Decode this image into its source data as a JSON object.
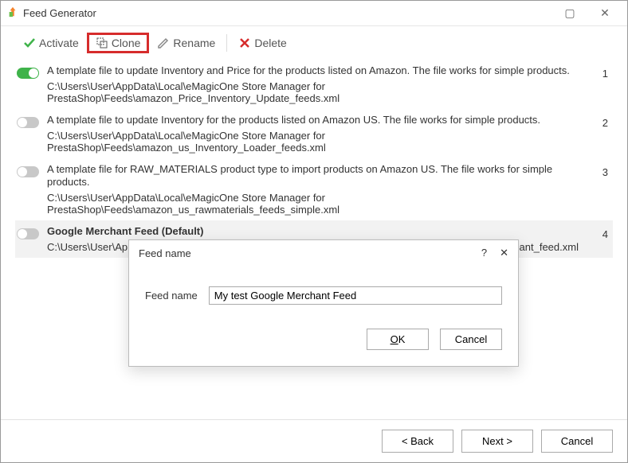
{
  "window": {
    "title": "Feed Generator",
    "maximize": "▢",
    "close": "✕"
  },
  "toolbar": {
    "activate": "Activate",
    "clone": "Clone",
    "rename": "Rename",
    "delete": "Delete"
  },
  "feeds": [
    {
      "desc": "A template file to update Inventory and Price for the products listed on Amazon. The file works for simple products.",
      "path": "C:\\Users\\User\\AppData\\Local\\eMagicOne Store Manager for PrestaShop\\Feeds\\amazon_Price_Inventory_Update_feeds.xml",
      "index": "1",
      "on": true,
      "selected": false
    },
    {
      "desc": "A template file to update Inventory for the products listed on Amazon US. The file works for simple products.",
      "path": "C:\\Users\\User\\AppData\\Local\\eMagicOne Store Manager for PrestaShop\\Feeds\\amazon_us_Inventory_Loader_feeds.xml",
      "index": "2",
      "on": false,
      "selected": false
    },
    {
      "desc": "A template file for RAW_MATERIALS product type to import products on Amazon US. The file works for simple products.",
      "path": "C:\\Users\\User\\AppData\\Local\\eMagicOne Store Manager for PrestaShop\\Feeds\\amazon_us_rawmaterials_feeds_simple.xml",
      "index": "3",
      "on": false,
      "selected": false
    },
    {
      "desc": "Google Merchant Feed (Default)",
      "path": "C:\\Users\\User\\AppData\\Local\\eMagicOne Store Manager for PrestaShop\\Feeds\\default_google_merchant_feed.xml",
      "index": "4",
      "on": false,
      "selected": true
    }
  ],
  "dialog": {
    "title": "Feed name",
    "help": "?",
    "close": "✕",
    "label": "Feed name",
    "value": "My test Google Merchant Feed",
    "ok": "OK",
    "cancel": "Cancel"
  },
  "wizard": {
    "back": "< Back",
    "next": "Next >",
    "cancel": "Cancel"
  }
}
